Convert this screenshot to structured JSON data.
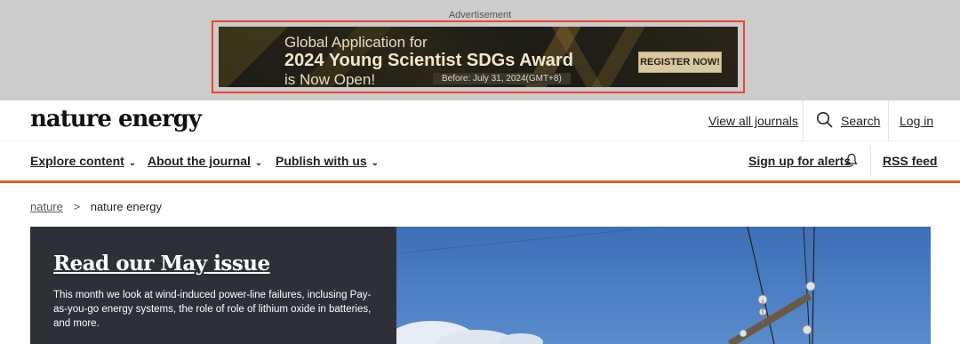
{
  "ad": {
    "label": "Advertisement",
    "line1": "Global Application for",
    "line2": "2024 Young Scientist SDGs Award",
    "line3": "is Now Open!",
    "date": "Before: July 31, 2024(GMT+8)",
    "cta": "REGISTER NOW!"
  },
  "header": {
    "logo": "nature energy",
    "view_all": "View all journals",
    "search": "Search",
    "login": "Log in"
  },
  "nav": {
    "items": [
      {
        "label": "Explore content"
      },
      {
        "label": "About the journal"
      },
      {
        "label": "Publish with us"
      }
    ],
    "alerts": "Sign up for alerts",
    "rss": "RSS feed"
  },
  "breadcrumb": {
    "root": "nature",
    "separator": ">",
    "current": "nature energy"
  },
  "hero": {
    "title": "Read our May issue",
    "description": "This month we look at wind-induced power-line failures, inclusing Pay-as-you-go energy systems, the role of role of lithium oxide in batteries, and more."
  },
  "colors": {
    "accent": "#e0622b",
    "hero_panel": "#2e3039",
    "ad_border": "#e8462f"
  }
}
